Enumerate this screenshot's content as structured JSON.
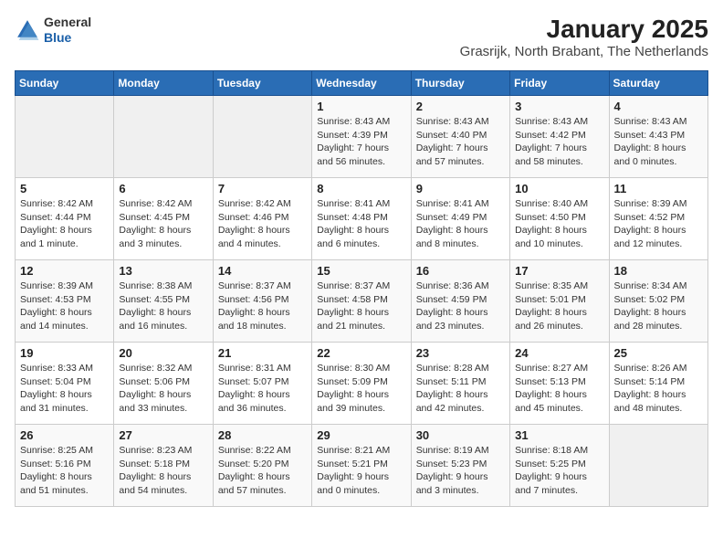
{
  "logo": {
    "line1": "General",
    "line2": "Blue"
  },
  "title": "January 2025",
  "subtitle": "Grasrijk, North Brabant, The Netherlands",
  "weekdays": [
    "Sunday",
    "Monday",
    "Tuesday",
    "Wednesday",
    "Thursday",
    "Friday",
    "Saturday"
  ],
  "weeks": [
    [
      {
        "day": "",
        "info": ""
      },
      {
        "day": "",
        "info": ""
      },
      {
        "day": "",
        "info": ""
      },
      {
        "day": "1",
        "info": "Sunrise: 8:43 AM\nSunset: 4:39 PM\nDaylight: 7 hours and 56 minutes."
      },
      {
        "day": "2",
        "info": "Sunrise: 8:43 AM\nSunset: 4:40 PM\nDaylight: 7 hours and 57 minutes."
      },
      {
        "day": "3",
        "info": "Sunrise: 8:43 AM\nSunset: 4:42 PM\nDaylight: 7 hours and 58 minutes."
      },
      {
        "day": "4",
        "info": "Sunrise: 8:43 AM\nSunset: 4:43 PM\nDaylight: 8 hours and 0 minutes."
      }
    ],
    [
      {
        "day": "5",
        "info": "Sunrise: 8:42 AM\nSunset: 4:44 PM\nDaylight: 8 hours and 1 minute."
      },
      {
        "day": "6",
        "info": "Sunrise: 8:42 AM\nSunset: 4:45 PM\nDaylight: 8 hours and 3 minutes."
      },
      {
        "day": "7",
        "info": "Sunrise: 8:42 AM\nSunset: 4:46 PM\nDaylight: 8 hours and 4 minutes."
      },
      {
        "day": "8",
        "info": "Sunrise: 8:41 AM\nSunset: 4:48 PM\nDaylight: 8 hours and 6 minutes."
      },
      {
        "day": "9",
        "info": "Sunrise: 8:41 AM\nSunset: 4:49 PM\nDaylight: 8 hours and 8 minutes."
      },
      {
        "day": "10",
        "info": "Sunrise: 8:40 AM\nSunset: 4:50 PM\nDaylight: 8 hours and 10 minutes."
      },
      {
        "day": "11",
        "info": "Sunrise: 8:39 AM\nSunset: 4:52 PM\nDaylight: 8 hours and 12 minutes."
      }
    ],
    [
      {
        "day": "12",
        "info": "Sunrise: 8:39 AM\nSunset: 4:53 PM\nDaylight: 8 hours and 14 minutes."
      },
      {
        "day": "13",
        "info": "Sunrise: 8:38 AM\nSunset: 4:55 PM\nDaylight: 8 hours and 16 minutes."
      },
      {
        "day": "14",
        "info": "Sunrise: 8:37 AM\nSunset: 4:56 PM\nDaylight: 8 hours and 18 minutes."
      },
      {
        "day": "15",
        "info": "Sunrise: 8:37 AM\nSunset: 4:58 PM\nDaylight: 8 hours and 21 minutes."
      },
      {
        "day": "16",
        "info": "Sunrise: 8:36 AM\nSunset: 4:59 PM\nDaylight: 8 hours and 23 minutes."
      },
      {
        "day": "17",
        "info": "Sunrise: 8:35 AM\nSunset: 5:01 PM\nDaylight: 8 hours and 26 minutes."
      },
      {
        "day": "18",
        "info": "Sunrise: 8:34 AM\nSunset: 5:02 PM\nDaylight: 8 hours and 28 minutes."
      }
    ],
    [
      {
        "day": "19",
        "info": "Sunrise: 8:33 AM\nSunset: 5:04 PM\nDaylight: 8 hours and 31 minutes."
      },
      {
        "day": "20",
        "info": "Sunrise: 8:32 AM\nSunset: 5:06 PM\nDaylight: 8 hours and 33 minutes."
      },
      {
        "day": "21",
        "info": "Sunrise: 8:31 AM\nSunset: 5:07 PM\nDaylight: 8 hours and 36 minutes."
      },
      {
        "day": "22",
        "info": "Sunrise: 8:30 AM\nSunset: 5:09 PM\nDaylight: 8 hours and 39 minutes."
      },
      {
        "day": "23",
        "info": "Sunrise: 8:28 AM\nSunset: 5:11 PM\nDaylight: 8 hours and 42 minutes."
      },
      {
        "day": "24",
        "info": "Sunrise: 8:27 AM\nSunset: 5:13 PM\nDaylight: 8 hours and 45 minutes."
      },
      {
        "day": "25",
        "info": "Sunrise: 8:26 AM\nSunset: 5:14 PM\nDaylight: 8 hours and 48 minutes."
      }
    ],
    [
      {
        "day": "26",
        "info": "Sunrise: 8:25 AM\nSunset: 5:16 PM\nDaylight: 8 hours and 51 minutes."
      },
      {
        "day": "27",
        "info": "Sunrise: 8:23 AM\nSunset: 5:18 PM\nDaylight: 8 hours and 54 minutes."
      },
      {
        "day": "28",
        "info": "Sunrise: 8:22 AM\nSunset: 5:20 PM\nDaylight: 8 hours and 57 minutes."
      },
      {
        "day": "29",
        "info": "Sunrise: 8:21 AM\nSunset: 5:21 PM\nDaylight: 9 hours and 0 minutes."
      },
      {
        "day": "30",
        "info": "Sunrise: 8:19 AM\nSunset: 5:23 PM\nDaylight: 9 hours and 3 minutes."
      },
      {
        "day": "31",
        "info": "Sunrise: 8:18 AM\nSunset: 5:25 PM\nDaylight: 9 hours and 7 minutes."
      },
      {
        "day": "",
        "info": ""
      }
    ]
  ]
}
